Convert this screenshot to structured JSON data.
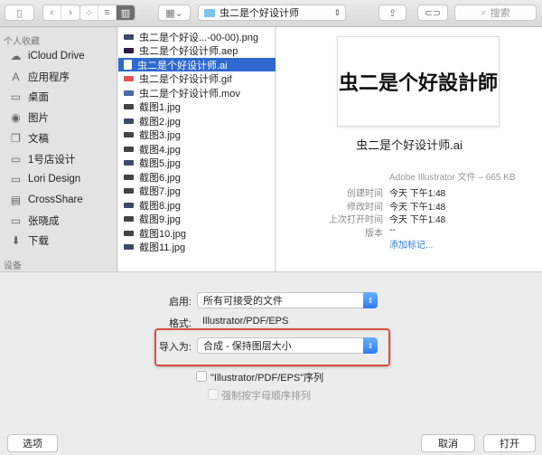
{
  "toolbar": {
    "path": "虫二是个好设计师",
    "search_placeholder": "搜索"
  },
  "sidebar": {
    "favorites_header": "个人收藏",
    "devices_header": "设备",
    "items": [
      {
        "label": "iCloud Drive",
        "icon": "☁"
      },
      {
        "label": "应用程序",
        "icon": "A"
      },
      {
        "label": "桌面",
        "icon": "▭"
      },
      {
        "label": "图片",
        "icon": "◉"
      },
      {
        "label": "文稿",
        "icon": "❐"
      },
      {
        "label": "1号店设计",
        "icon": "▭"
      },
      {
        "label": "Lori Design",
        "icon": "▭"
      },
      {
        "label": "CrossShare",
        "icon": "▤"
      },
      {
        "label": "张晓成",
        "icon": "▭"
      },
      {
        "label": "下载",
        "icon": "⬇"
      }
    ]
  },
  "files": [
    "虫二是个好设...-00-00).png",
    "虫二是个好设计师.aep",
    "虫二是个好设计师.ai",
    "虫二是个好设计师.gif",
    "虫二是个好设计师.mov",
    "截图1.jpg",
    "截图2.jpg",
    "截图3.jpg",
    "截图4.jpg",
    "截图5.jpg",
    "截图6.jpg",
    "截图7.jpg",
    "截图8.jpg",
    "截图9.jpg",
    "截图10.jpg",
    "截图11.jpg"
  ],
  "preview": {
    "thumb_text": "虫二是个好設計師",
    "name": "虫二是个好设计师.ai",
    "kind": "Adobe Illustrator 文件 – 665 KB",
    "meta": [
      {
        "k": "创建时间",
        "v": "今天 下午1:48"
      },
      {
        "k": "修改时间",
        "v": "今天 下午1:48"
      },
      {
        "k": "上次打开时间",
        "v": "今天 下午1:48"
      },
      {
        "k": "版本",
        "v": "--"
      }
    ],
    "add_tags": "添加标记..."
  },
  "options": {
    "enable_label": "启用:",
    "enable_value": "所有可接受的文件",
    "format_label": "格式:",
    "format_value": "Illustrator/PDF/EPS",
    "import_label": "导入为:",
    "import_value": "合成 - 保持图层大小",
    "seq_label": "\"Illustrator/PDF/EPS\"序列",
    "alpha_label": "强制按字母顺序排列"
  },
  "buttons": {
    "options": "选项",
    "cancel": "取消",
    "open": "打开"
  },
  "colors": {
    "highlight": "#d9503f",
    "selection": "#2f68d0"
  }
}
